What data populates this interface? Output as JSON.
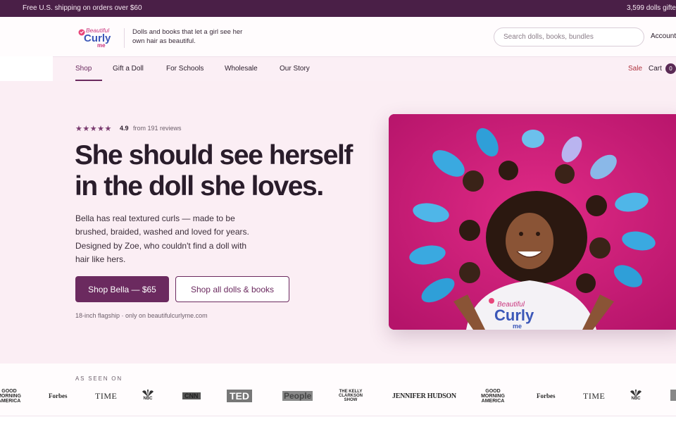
{
  "announcement": {
    "left_text": "Free U.S. shipping on orders over $60",
    "right_text": "3,599 dolls gifte"
  },
  "header": {
    "logo_text": "Beautiful Curly me",
    "tagline": "Dolls and books that let a girl see her own hair as beautiful.",
    "search_placeholder": "Search dolls, books, bundles",
    "account_label": "Account"
  },
  "nav": {
    "items": [
      {
        "label": "Shop",
        "active": true
      },
      {
        "label": "Gift a Doll"
      },
      {
        "label": "For Schools"
      },
      {
        "label": "Wholesale"
      },
      {
        "label": "Our Story"
      }
    ],
    "sale_label": "Sale",
    "cart_label": "Cart",
    "cart_count": "0"
  },
  "hero": {
    "stars": "★★★★★",
    "rating": "4.9",
    "reviews": "from 191 reviews",
    "headline": "She should see herself in the doll she loves.",
    "body": "Bella has real textured curls — made to be brushed, braided, washed and loved for years. Designed by Zoe, who couldn't find a doll with hair like hers.",
    "primary_cta": "Shop Bella — $65",
    "secondary_cta": "Shop all dolls & books",
    "fineprint": "18-inch flagship · only on beautifulcurlyme.com",
    "shirt_logo": "Beautiful Curly me"
  },
  "press": {
    "label": "AS SEEN ON",
    "logos": [
      "GOOD MORNING AMERICA",
      "Forbes",
      "TIME",
      "NBC",
      "CNN",
      "TED",
      "People",
      "THE KELLY CLARKSON SHOW",
      "JENNIFER HUDSON",
      "GOOD MORNING AMERICA",
      "Forbes",
      "TIME",
      "NBC"
    ]
  },
  "colors": {
    "brand": "#6b2a5f",
    "announcement_bg": "#4a1f47",
    "hero_bg": "#fbeef4",
    "sale": "#b0343f"
  }
}
